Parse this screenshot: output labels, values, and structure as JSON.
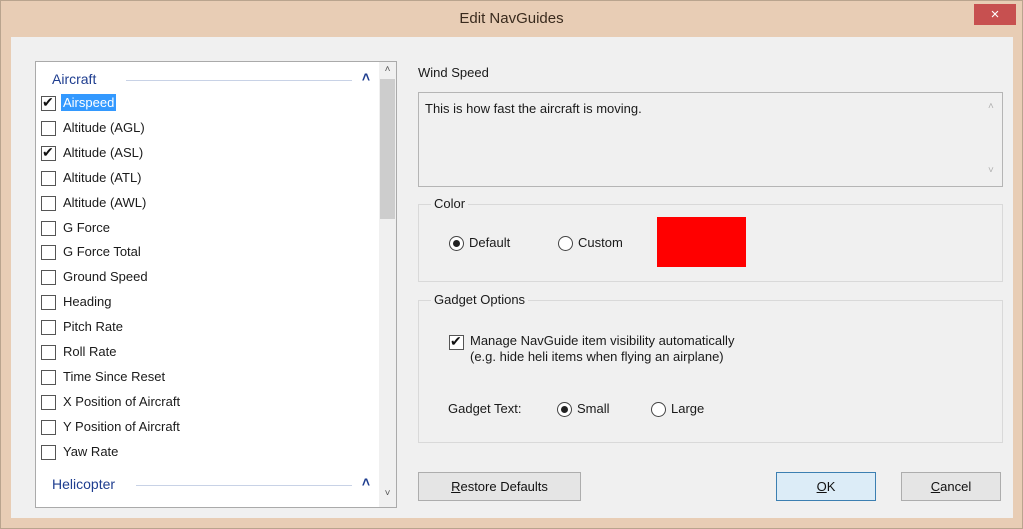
{
  "window": {
    "title": "Edit NavGuides",
    "close_glyph": "×"
  },
  "list": {
    "groups": [
      {
        "label": "Aircraft",
        "caret": "˄"
      },
      {
        "label": "Helicopter",
        "caret": "˄"
      }
    ],
    "items": [
      {
        "label": "Airspeed",
        "checked": true,
        "selected": true
      },
      {
        "label": "Altitude (AGL)",
        "checked": false
      },
      {
        "label": "Altitude (ASL)",
        "checked": true
      },
      {
        "label": "Altitude (ATL)",
        "checked": false
      },
      {
        "label": "Altitude (AWL)",
        "checked": false
      },
      {
        "label": "G Force",
        "checked": false
      },
      {
        "label": "G Force Total",
        "checked": false
      },
      {
        "label": "Ground Speed",
        "checked": false
      },
      {
        "label": "Heading",
        "checked": false
      },
      {
        "label": "Pitch Rate",
        "checked": false
      },
      {
        "label": "Roll Rate",
        "checked": false
      },
      {
        "label": "Time Since Reset",
        "checked": false
      },
      {
        "label": "X Position of Aircraft",
        "checked": false
      },
      {
        "label": "Y Position of Aircraft",
        "checked": false
      },
      {
        "label": "Yaw Rate",
        "checked": false
      }
    ],
    "scroll_up": "˄",
    "scroll_down": "˅"
  },
  "detail": {
    "name": "Wind Speed",
    "description": "This is how fast the aircraft is moving."
  },
  "color": {
    "group_label": "Color",
    "default_label": "Default",
    "custom_label": "Custom",
    "selected": "Default",
    "swatch": "#ff0000"
  },
  "gadget": {
    "group_label": "Gadget Options",
    "auto_visibility_label": "Manage NavGuide item visibility automatically",
    "auto_visibility_hint": "(e.g. hide heli items when flying an airplane)",
    "auto_visibility_checked": true,
    "text_label": "Gadget Text:",
    "small_label": "Small",
    "large_label": "Large",
    "text_selected": "Small"
  },
  "buttons": {
    "restore_mnemonic": "R",
    "restore_rest": "estore Defaults",
    "ok_mnemonic": "O",
    "ok_rest": "K",
    "cancel_mnemonic": "C",
    "cancel_rest": "ancel"
  }
}
